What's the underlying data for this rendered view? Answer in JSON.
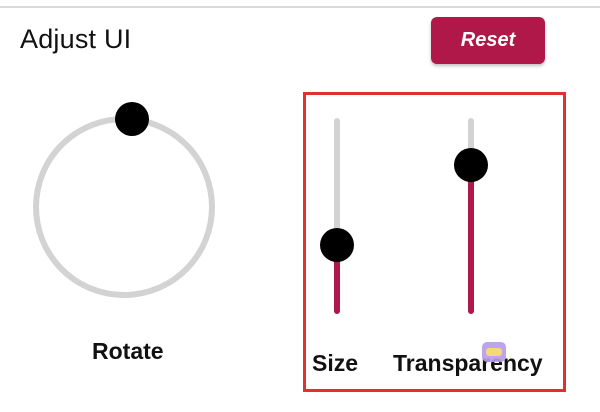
{
  "header": {
    "title": "Adjust UI",
    "reset_label": "Reset"
  },
  "controls": {
    "rotate": {
      "label": "Rotate",
      "angle_deg": 0
    },
    "size": {
      "label": "Size",
      "value_fraction": 0.35
    },
    "transparency": {
      "label": "Transparency",
      "value_fraction": 0.76
    }
  },
  "colors": {
    "accent": "#b0184a",
    "track": "#d3d3d3",
    "thumb": "#000000",
    "highlight": "#e03030"
  },
  "icons": [
    "sticker-icon"
  ]
}
